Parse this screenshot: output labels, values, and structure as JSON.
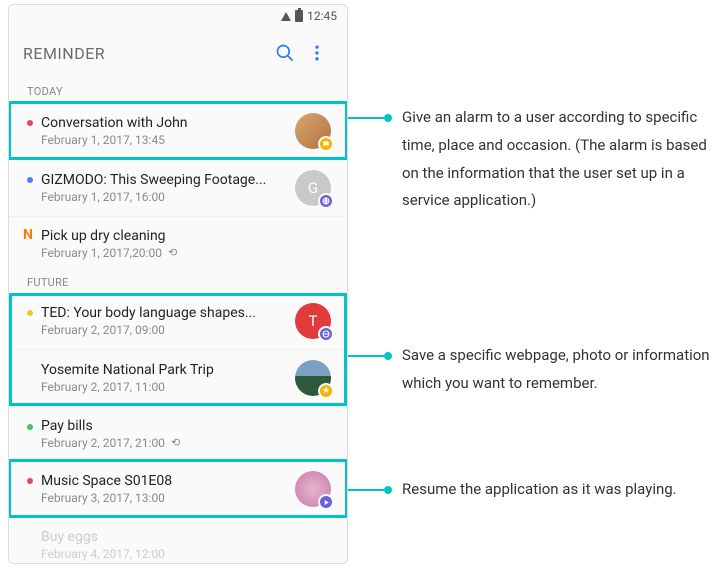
{
  "status": {
    "time": "12:45"
  },
  "header": {
    "title": "REMINDER"
  },
  "sections": {
    "today": "TODAY",
    "future": "FUTURE"
  },
  "items": {
    "convJohn": {
      "title": "Conversation with John",
      "date": "February 1, 2017, 13:45"
    },
    "gizmodo": {
      "title": "GIZMODO: This Sweeping Footage...",
      "date": "February 1, 2017, 16:00",
      "avatarLetter": "G"
    },
    "dryclean": {
      "title": "Pick up dry cleaning",
      "date": "February 1, 2017,20:00"
    },
    "ted": {
      "title": "TED: Your body language shapes...",
      "date": "February 2, 2017, 09:00",
      "avatarLetter": "T"
    },
    "yosemite": {
      "title": "Yosemite National Park Trip",
      "date": "February 2, 2017, 11:00"
    },
    "paybills": {
      "title": "Pay bills",
      "date": "February 2, 2017, 21:00"
    },
    "music": {
      "title": "Music Space S01E08",
      "date": "February 3, 2017, 13:00"
    },
    "buyeggs": {
      "title": "Buy eggs",
      "date": "February 4, 2017, 12:00"
    }
  },
  "callouts": {
    "alarm": "Give an alarm to a user according to specific time, place and occasion. (The alarm is based on the information that the user set up in a service application.)",
    "save": "Save a specific webpage, photo or information which you want to remember.",
    "resume": "Resume the application as it was playing."
  },
  "colors": {
    "accent": "#00c4c4",
    "dotRed": "#e8445a",
    "dotBlue": "#4a80ff",
    "dotYellow": "#f3c22b",
    "dotGreen": "#3cc26a",
    "badgeYellow": "#f5b400",
    "badgePurple": "#6a62d8",
    "avatarRed": "#e23b3b",
    "avatarGray": "#c9c9c9"
  }
}
